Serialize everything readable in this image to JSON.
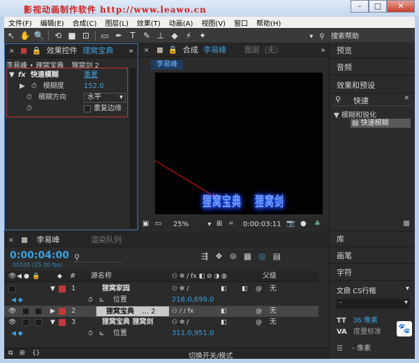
{
  "window": {
    "title": "影视动画制作软件  http://www.leawo.cn"
  },
  "menu": [
    "文件(F)",
    "编辑(E)",
    "合成(C)",
    "图层(L)",
    "效果(T)",
    "动画(A)",
    "视图(V)",
    "窗口",
    "帮助(H)"
  ],
  "toolbar": {
    "search_label": "搜索帮助"
  },
  "effect_controls": {
    "tab_label": "效果控件",
    "tab_comp": "理窝宝典",
    "breadcrumb": "李易峰 • 理窝宝典",
    "layer_label": "狸窝剑 2",
    "effect_name": "快速模糊",
    "reset_label": "重置",
    "blurriness_label": "模糊度",
    "blurriness_value": "152.0",
    "direction_label": "模糊方向",
    "direction_value": "水平",
    "repeat_label": "重复边缘"
  },
  "composition": {
    "tab_label": "合成",
    "tab_name": "李易峰",
    "footage_tab": "图层（无）",
    "comp_chip": "李易峰",
    "zoom": "25%",
    "timecode": "0:00:03:11",
    "glow_text_1": "狸窝宝典",
    "glow_text_2": "狸窝剑"
  },
  "right_panels": {
    "preview": "预览",
    "audio": "音频",
    "effects_presets": "效果和预设",
    "search_value": "快速",
    "category": "模糊和锐化",
    "effect_item": "快速模糊",
    "library": "库",
    "brush": "画笔",
    "character": "字符",
    "font_name": "文鼎 CS行楷",
    "font_style": "-",
    "font_size": "36 像素",
    "tracking": "度量标准",
    "leading": "- 像素"
  },
  "timeline": {
    "tab_label": "李易峰",
    "render_queue": "渲染队列",
    "timecode": "0:00:04:00",
    "frames": "00100 (25.00 fps)",
    "col_num": "#",
    "col_source": "源名称",
    "col_parent": "父级",
    "parent_value": "无",
    "layers": [
      {
        "num": "1",
        "name": "狸窝家园",
        "color": "#c03a3a"
      },
      {
        "num": "2",
        "name": "狸窝宝典",
        "suffix": "... 2",
        "color": "#c03a3a"
      },
      {
        "num": "3",
        "name": "狸窝宝典    狸窝剑",
        "color": "#c03a3a"
      }
    ],
    "position_label": "位置",
    "position_1": "216.0,699.0",
    "position_3": "311.0,951.0",
    "toggle_label": "切换开关/模式"
  }
}
